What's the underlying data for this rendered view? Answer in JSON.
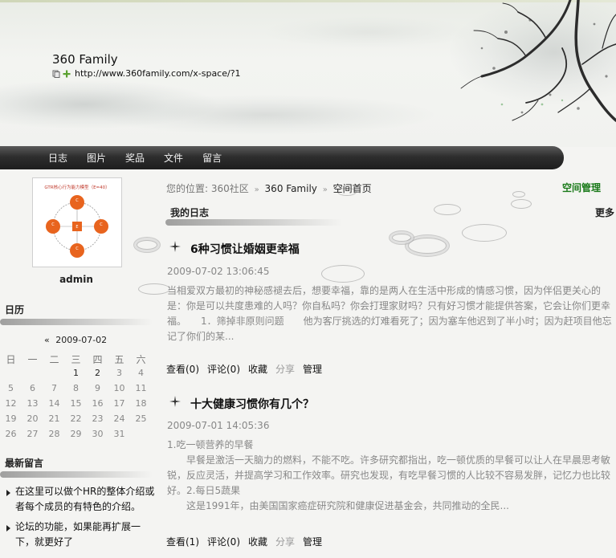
{
  "site": {
    "title": "360 Family",
    "url": "http://www.360family.com/x-space/?1"
  },
  "nav": {
    "items": [
      "日志",
      "图片",
      "奖品",
      "文件",
      "留言"
    ]
  },
  "sidebar": {
    "avatar_caption": "GTR核心行为能力模型（E=40）",
    "admin_name": "admin",
    "calendar": {
      "heading": "日历",
      "prev": "«",
      "month": "2009-07-02",
      "weekdays": [
        "日",
        "一",
        "二",
        "三",
        "四",
        "五",
        "六"
      ],
      "weeks": [
        [
          "",
          "",
          "",
          "1",
          "2",
          "3",
          "4"
        ],
        [
          "5",
          "6",
          "7",
          "8",
          "9",
          "10",
          "11"
        ],
        [
          "12",
          "13",
          "14",
          "15",
          "16",
          "17",
          "18"
        ],
        [
          "19",
          "20",
          "21",
          "22",
          "23",
          "24",
          "25"
        ],
        [
          "26",
          "27",
          "28",
          "29",
          "30",
          "31",
          ""
        ]
      ]
    },
    "messages": {
      "heading": "最新留言",
      "items": [
        "在这里可以做个HR的整体介绍或者每个成员的有特色的介绍。",
        "论坛的功能，如果能再扩展一下，就更好了"
      ]
    }
  },
  "breadcrumb": {
    "prefix": "您的位置: 360社区",
    "sep": "»",
    "items": [
      "360 Family",
      "空间首页"
    ]
  },
  "space_admin": "空间管理",
  "section": {
    "title": "我的日志",
    "more": "更多"
  },
  "posts": [
    {
      "title": "6种习惯让婚姻更幸福",
      "date": "2009-07-02 13:06:45",
      "body": "当相爱双方最初的神秘感褪去后，想要幸福，靠的是两人在生活中形成的情感习惯，因为伴侣更关心的是：你是可以共度患难的人吗？你自私吗？你会打理家财吗？只有好习惯才能提供答案，它会让你们更幸福。　　1．筛掉非原则问题　　他为客厅挑选的灯难看死了；因为塞车他迟到了半小时；因为赶项目他忘记了你们的某...",
      "actions": {
        "view": "查看(0)",
        "comment": "评论(0)",
        "favorite": "收藏",
        "share": "分享",
        "manage": "管理"
      }
    },
    {
      "title": "十大健康习惯你有几个？",
      "date": "2009-07-01 14:05:36",
      "body_lines": [
        "1.吃一顿营养的早餐",
        "　　早餐是激活一天脑力的燃料，不能不吃。许多研究都指出，吃一顿优质的早餐可以让人在早晨思考敏锐，反应灵活，并提高学习和工作效率。研究也发现，有吃早餐习惯的人比较不容易发胖，记忆力也比较好。2.每日5蔬果",
        "　　这是1991年，由美国国家癌症研究院和健康促进基金会，共同推动的全民..."
      ],
      "actions": {
        "view": "查看(1)",
        "comment": "评论(0)",
        "favorite": "收藏",
        "share": "分享",
        "manage": "管理"
      }
    }
  ],
  "colors": {
    "nav_bg": "#2e2e2e",
    "space_admin": "#1a7a1a",
    "muted_text": "#888888"
  }
}
